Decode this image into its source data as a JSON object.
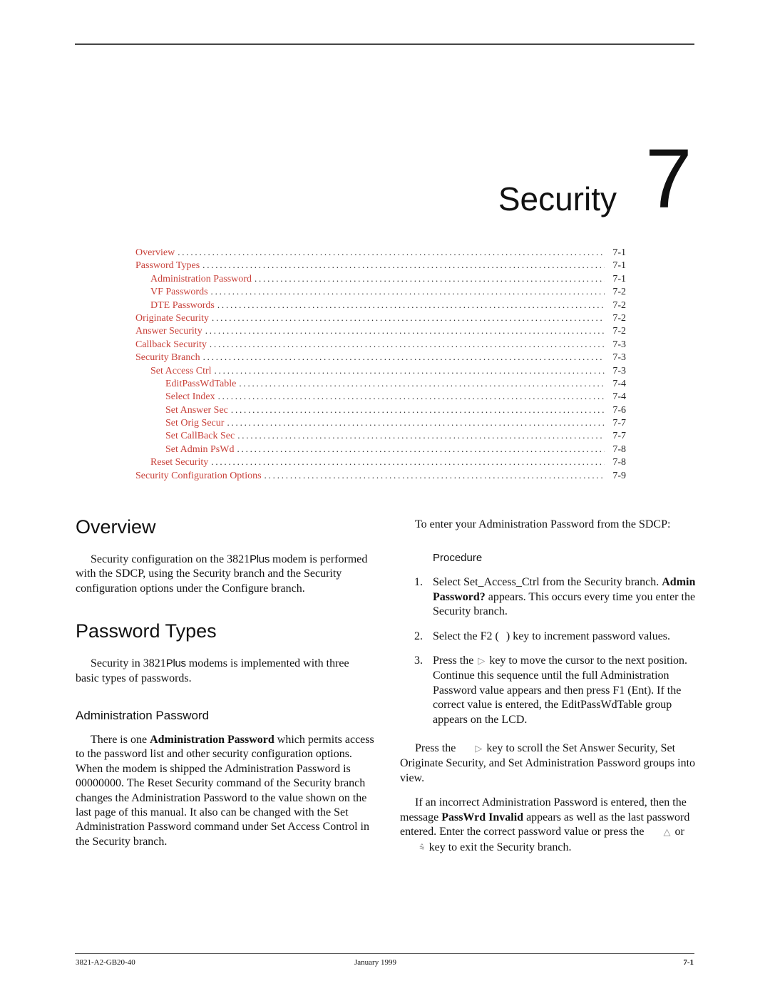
{
  "chapter": {
    "title": "Security",
    "number": "7"
  },
  "toc": [
    {
      "label": "Overview",
      "page": "7-1",
      "level": 1
    },
    {
      "label": "Password Types",
      "page": "7-1",
      "level": 1
    },
    {
      "label": "Administration Password",
      "page": "7-1",
      "level": 2
    },
    {
      "label": "VF Passwords",
      "page": "7-2",
      "level": 2
    },
    {
      "label": "DTE Passwords",
      "page": "7-2",
      "level": 2
    },
    {
      "label": "Originate Security",
      "page": "7-2",
      "level": 1
    },
    {
      "label": "Answer Security",
      "page": "7-2",
      "level": 1
    },
    {
      "label": "Callback Security",
      "page": "7-3",
      "level": 1
    },
    {
      "label": "Security Branch",
      "page": "7-3",
      "level": 1
    },
    {
      "label": "Set Access Ctrl",
      "page": "7-3",
      "level": 2
    },
    {
      "label": "EditPassWdTable",
      "page": "7-4",
      "level": 3
    },
    {
      "label": "Select Index",
      "page": "7-4",
      "level": 3
    },
    {
      "label": "Set Answer Sec",
      "page": "7-6",
      "level": 3
    },
    {
      "label": "Set Orig Secur",
      "page": "7-7",
      "level": 3
    },
    {
      "label": "Set CallBack Sec",
      "page": "7-7",
      "level": 3
    },
    {
      "label": "Set Admin PsWd",
      "page": "7-8",
      "level": 3
    },
    {
      "label": "Reset Security",
      "page": "7-8",
      "level": 2
    },
    {
      "label": "Security Configuration Options",
      "page": "7-9",
      "level": 1
    }
  ],
  "left": {
    "overview_heading": "Overview",
    "overview_p1_a": "Security configuration on the 3821",
    "overview_p1_plus": "Plus",
    "overview_p1_b": "modem is performed with the SDCP, using the Security branch and the Security configuration options under the Configure branch.",
    "pwtypes_heading": "Password Types",
    "pwtypes_p1_a": "Security in 3821",
    "pwtypes_p1_plus": "Plus",
    "pwtypes_p1_b": "modems is implemented with three basic types of passwords.",
    "admin_heading": "Administration Password",
    "admin_p1_a": "There is one ",
    "admin_p1_bold": "Administration Password",
    "admin_p1_b": " which permits access to the password list and other security configuration options. When the modem is shipped the Administration Password is 00000000. The Reset Security command of the Security branch changes the Administration Password to the value shown on the last page of this manual. It also can be changed with the Set Administration Password command under Set Access Control in the Security branch."
  },
  "right": {
    "intro": "To enter your Administration Password from the SDCP:",
    "procedure_title": "Procedure",
    "steps": [
      {
        "num": "1.",
        "a": "Select Set_Access_Ctrl from the Security branch. ",
        "bold": "Admin Password?",
        "b": " appears. This occurs every time you enter the Security branch."
      },
      {
        "num": "2.",
        "a": "Select the F2 (",
        "b": ") key to increment password values."
      },
      {
        "num": "3.",
        "a": "Press the",
        "b": "key to move the cursor to the next position. Continue this sequence until the full Administration Password value appears and then press F1 (Ent). If the correct value is entered, the EditPassWdTable group appears on the LCD."
      }
    ],
    "scroll_p_a": "Press the",
    "scroll_p_b": "key to scroll the Set Answer Security, Set Originate Security, and Set Administration Password groups into view.",
    "invalid_p_a": "If an incorrect Administration Password is entered, then the message ",
    "invalid_p_bold": "PassWrd Invalid",
    "invalid_p_b": " appears as well as the last password entered. Enter the correct password value or press the",
    "invalid_p_or": "or",
    "invalid_p_c": "key to exit the Security branch."
  },
  "icons": {
    "right_key": "right-arrow-key-icon",
    "up_key": "up-arrow-key-icon",
    "top_key": "double-up-arrow-key-icon"
  },
  "colors": {
    "toc_link": "#c8413a"
  },
  "footer": {
    "doc_number": "3821-A2-GB20-40",
    "date": "January 1999",
    "page": "7-1"
  }
}
